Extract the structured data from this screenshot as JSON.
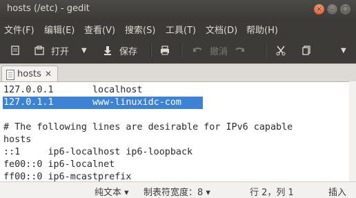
{
  "window": {
    "title": "hosts (/etc) - gedit"
  },
  "menu": [
    "文件(F)",
    "编辑(E)",
    "查看(V)",
    "搜索(S)",
    "工具(T)",
    "文档(D)",
    "帮助(H)"
  ],
  "toolbar": {
    "open_label": "打开",
    "save_label": "保存",
    "undo_label": "撤消"
  },
  "tab": {
    "label": "hosts",
    "close_glyph": "✕"
  },
  "editor": {
    "lines": [
      "127.0.0.1       localhost",
      "127.0.1.1       www-linuxidc-com",
      "",
      "# The following lines are desirable for IPv6 capable",
      "hosts",
      "::1     ip6-localhost ip6-loopback",
      "fe00::0 ip6-localnet",
      "ff00::0 ip6-mcastprefix"
    ],
    "selected_line": 2
  },
  "status": {
    "language": "纯文本 ▾",
    "tab_width": "制表符宽度：8 ▾",
    "position": "行 2，列 1",
    "mode": "插入"
  },
  "colors": {
    "accent": "#dd4814",
    "selection": "#3d83d5",
    "toolbar": "#3c3b37"
  }
}
